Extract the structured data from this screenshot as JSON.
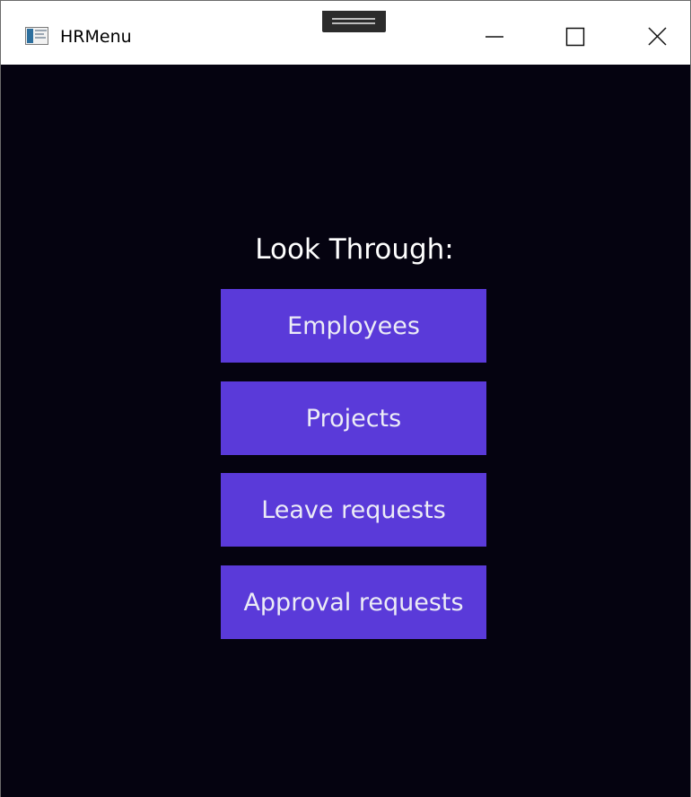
{
  "window": {
    "title": "HRMenu",
    "icon": "app-window-icon",
    "controls": {
      "minimize": "minimize-icon",
      "maximize": "maximize-icon",
      "close": "close-icon"
    }
  },
  "main": {
    "heading": "Look Through:",
    "buttons": [
      {
        "label": "Employees"
      },
      {
        "label": "Projects"
      },
      {
        "label": "Leave requests"
      },
      {
        "label": "Approval requests"
      }
    ]
  },
  "colors": {
    "background": "#050310",
    "button": "#5a3ad9",
    "button_text": "#ececf6",
    "heading_text": "#ffffff"
  }
}
